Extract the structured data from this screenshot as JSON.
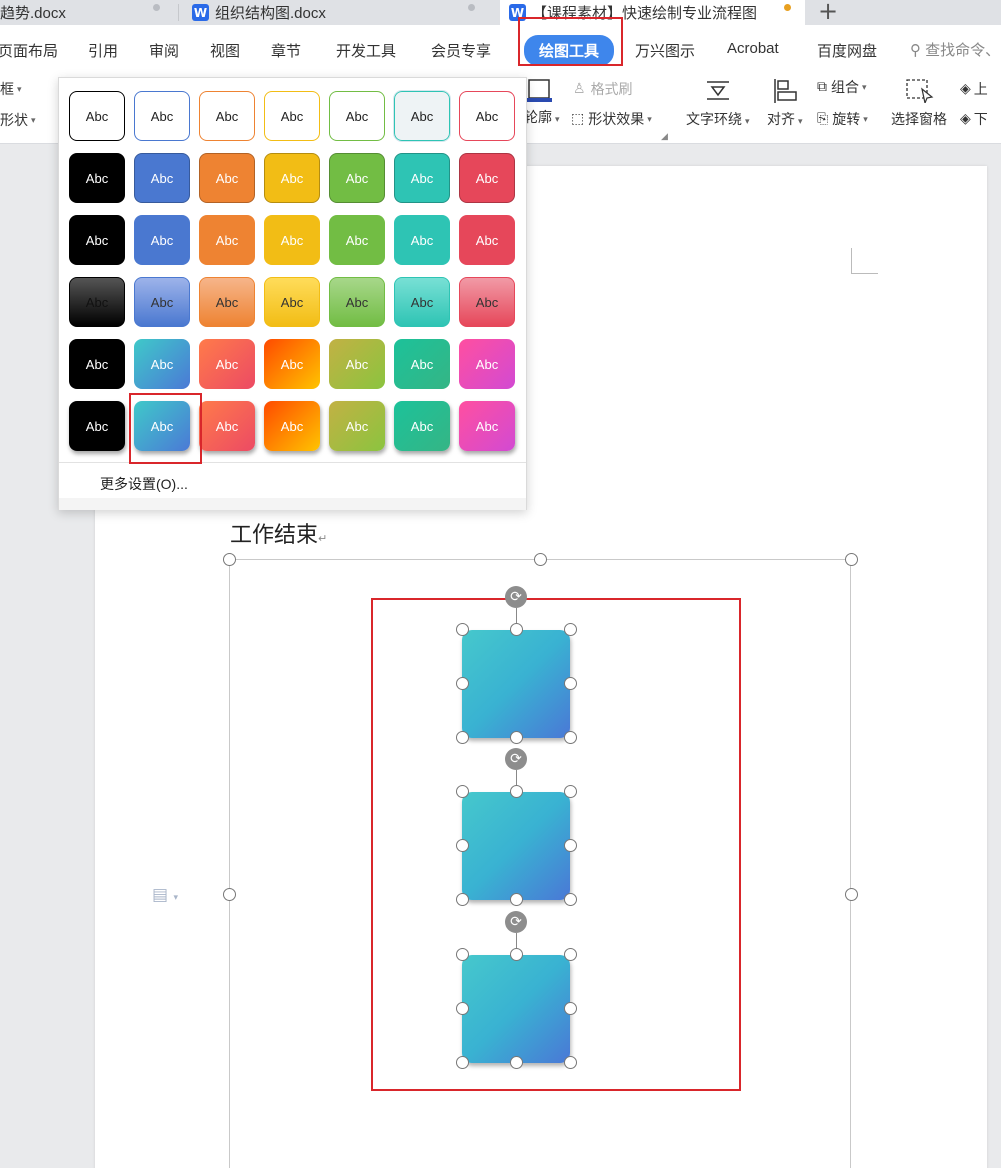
{
  "tabs": [
    {
      "title": "趋势.docx",
      "active": false
    },
    {
      "title": "组织结构图.docx",
      "active": false
    },
    {
      "title": "【课程素材】快速绘制专业流程图",
      "active": true
    }
  ],
  "menu": {
    "items": [
      "页面布局",
      "引用",
      "审阅",
      "视图",
      "章节",
      "开发工具",
      "会员专享",
      "绘图工具",
      "万兴图示",
      "Acrobat",
      "百度网盘"
    ],
    "active": "绘图工具",
    "search": "查找命令、"
  },
  "ribbon": {
    "left_top": "框",
    "left_bottom": "形状",
    "format_painter": "格式刷",
    "outline": "轮廓",
    "shape_effects": "形状效果",
    "text_wrap": "文字环绕",
    "align": "对齐",
    "group": "组合",
    "rotate": "旋转",
    "selection_pane": "选择窗格",
    "bring_up": "上",
    "send_down": "下"
  },
  "gallery": {
    "sample_text": "Abc",
    "more_settings": "更多设置(O)...",
    "colors": {
      "black": "#000000",
      "blue": "#4a78d0",
      "orange": "#ee8332",
      "yellow": "#f2bd15",
      "green": "#72bd44",
      "teal": "#2ec4b4",
      "red": "#e6475a"
    }
  },
  "document": {
    "heading": "工作结束"
  }
}
